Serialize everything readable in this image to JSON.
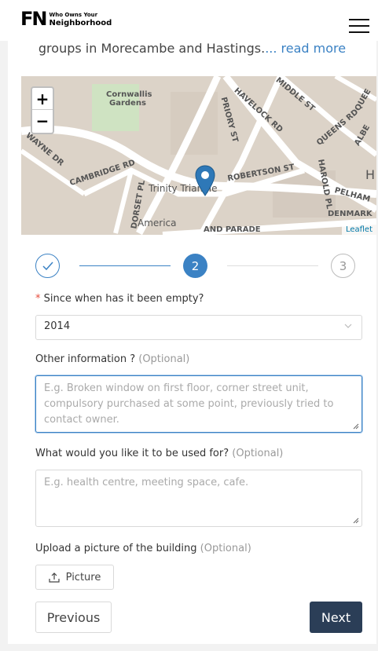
{
  "header": {
    "logo_mark": "FN",
    "logo_small": "Who Owns Your",
    "logo_big": "Neighborhood",
    "menu_icon": "hamburger-icon"
  },
  "intro": {
    "text": "groups in Morecambe and Hastings.",
    "read_more": "... read more"
  },
  "map": {
    "zoom_in": "+",
    "zoom_out": "−",
    "attribution": "Leaflet",
    "labels": {
      "cornwallis": "Cornwallis",
      "gardens": "Gardens",
      "priory": "PRIORY ST",
      "havelock": "HAVELOCK RD",
      "middle": "MIDDLE ST",
      "queens": "QUEENS RD",
      "albe": "ALBE",
      "queen": "QUEE",
      "wayne": "WAYNE DR",
      "cambridge": "CAMBRIDGE RD",
      "robertson": "ROBERTSON ST",
      "harold": "HAROLD PL",
      "pelham": "PELHAM",
      "trinity": "Trinity Triangle",
      "dorset": "DORSET PL",
      "america": "America",
      "denmark": "DENMARK",
      "parade": "AND PARADE",
      "h": "H"
    },
    "marker_icon": "map-pin-icon"
  },
  "stepper": {
    "step1_icon": "check-icon",
    "step2": "2",
    "step3": "3"
  },
  "form": {
    "empty_since": {
      "required_mark": "*",
      "label": "Since when has it been empty?",
      "value": "2014"
    },
    "other_info": {
      "label": "Other information ?",
      "optional": "(Optional)",
      "placeholder": "E.g. Broken window on first floor, corner street unit, compulsory purchased at some point, previously tried to contact owner."
    },
    "use_for": {
      "label": "What would you like it to be used for?",
      "optional": "(Optional)",
      "placeholder": "E.g. health centre, meeting space, cafe."
    },
    "upload": {
      "label": "Upload a picture of the building",
      "optional": "(Optional)",
      "button": "Picture"
    }
  },
  "actions": {
    "previous": "Previous",
    "next": "Next"
  }
}
